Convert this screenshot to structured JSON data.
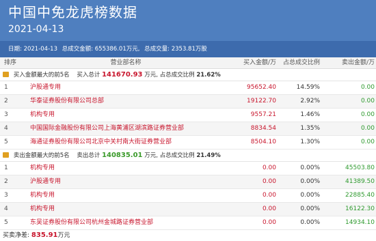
{
  "header": {
    "title": "中国中免龙虎榜数据",
    "date": "2021-04-13"
  },
  "info": {
    "date_label": "日期:",
    "date": "2021-04-13",
    "total_amount_label": "总成交金额:",
    "total_amount": "655386.01万元,",
    "total_volume_label": "总成交量:",
    "total_volume": "2353.81万股"
  },
  "columns": {
    "rank": "排序",
    "name": "营业部名称",
    "buy": "买入金额/万",
    "ratio": "占总成交比例",
    "sell": "卖出金额/万"
  },
  "buy_section": {
    "label": "买入金额最大的前5名",
    "total_label": "买入总计",
    "total": "141670.93",
    "unit": "万元,",
    "ratio_label": "占总成交比例",
    "ratio": "21.62%"
  },
  "buy_rows": [
    {
      "rank": "1",
      "name": "沪股通专用",
      "buy": "95652.40",
      "ratio": "14.59%",
      "sell": "0.00"
    },
    {
      "rank": "2",
      "name": "华泰证券股份有限公司总部",
      "buy": "19122.70",
      "ratio": "2.92%",
      "sell": "0.00"
    },
    {
      "rank": "3",
      "name": "机构专用",
      "buy": "9557.21",
      "ratio": "1.46%",
      "sell": "0.00"
    },
    {
      "rank": "4",
      "name": "中国国际金融股份有限公司上海黄浦区湖滨路证券营业部",
      "buy": "8834.54",
      "ratio": "1.35%",
      "sell": "0.00"
    },
    {
      "rank": "5",
      "name": "海通证券股份有限公司北京中关村南大街证券营业部",
      "buy": "8504.10",
      "ratio": "1.30%",
      "sell": "0.00"
    }
  ],
  "sell_section": {
    "label": "卖出金额最大的前5名",
    "total_label": "卖出总计",
    "total": "140835.01",
    "unit": "万元,",
    "ratio_label": "占总成交比例",
    "ratio": "21.49%"
  },
  "sell_rows": [
    {
      "rank": "1",
      "name": "机构专用",
      "buy": "0.00",
      "ratio": "0.00%",
      "sell": "45503.80"
    },
    {
      "rank": "2",
      "name": "沪股通专用",
      "buy": "0.00",
      "ratio": "0.00%",
      "sell": "41389.50"
    },
    {
      "rank": "3",
      "name": "机构专用",
      "buy": "0.00",
      "ratio": "0.00%",
      "sell": "22885.40"
    },
    {
      "rank": "4",
      "name": "机构专用",
      "buy": "0.00",
      "ratio": "0.00%",
      "sell": "16122.30"
    },
    {
      "rank": "5",
      "name": "东吴证券股份有限公司杭州金城路证券营业部",
      "buy": "0.00",
      "ratio": "0.00%",
      "sell": "14934.10"
    }
  ],
  "net": {
    "label": "买卖净差:",
    "value": "835.91",
    "unit": "万元"
  },
  "colors": {
    "header_bg": "#4f7fbf",
    "info_bg": "#3d6bad",
    "buy_red": "#c8162d",
    "sell_green": "#2e9a2e",
    "section_icon": "#e0a020"
  }
}
